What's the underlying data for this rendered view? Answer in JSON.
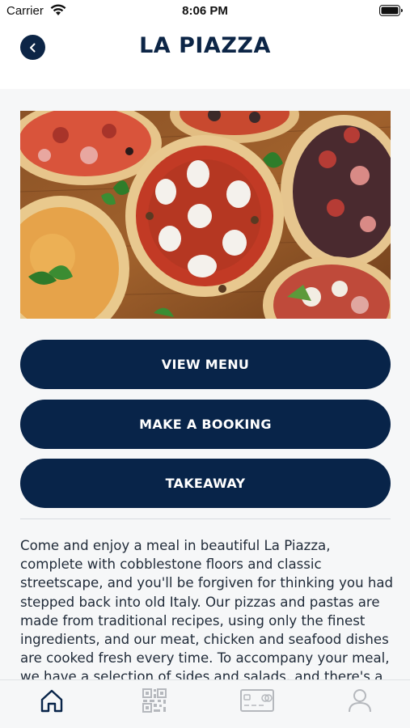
{
  "status_bar": {
    "carrier": "Carrier",
    "time": "8:06 PM"
  },
  "header": {
    "title": "LA PIAZZA"
  },
  "actions": {
    "view_menu": "VIEW MENU",
    "make_booking": "MAKE A BOOKING",
    "takeaway": "TAKEAWAY"
  },
  "description": "Come and enjoy a meal in beautiful La Piazza, complete with cobblestone floors and classic streetscape, and you'll be forgiven for thinking you had stepped back into old Italy. Our pizzas and pastas are made from traditional recipes, using only the finest ingredients, and our meat, chicken and seafood dishes are cooked fresh every time. To accompany your meal, we have a selection of sides and salads, and there's a special menu for the",
  "tab_bar": {
    "items": [
      "home-icon",
      "qr-code-icon",
      "card-icon",
      "profile-icon"
    ],
    "active": "home-icon"
  },
  "colors": {
    "primary": "#082449",
    "background": "#f6f7f8",
    "inactive_icon": "#b5b8bd"
  }
}
